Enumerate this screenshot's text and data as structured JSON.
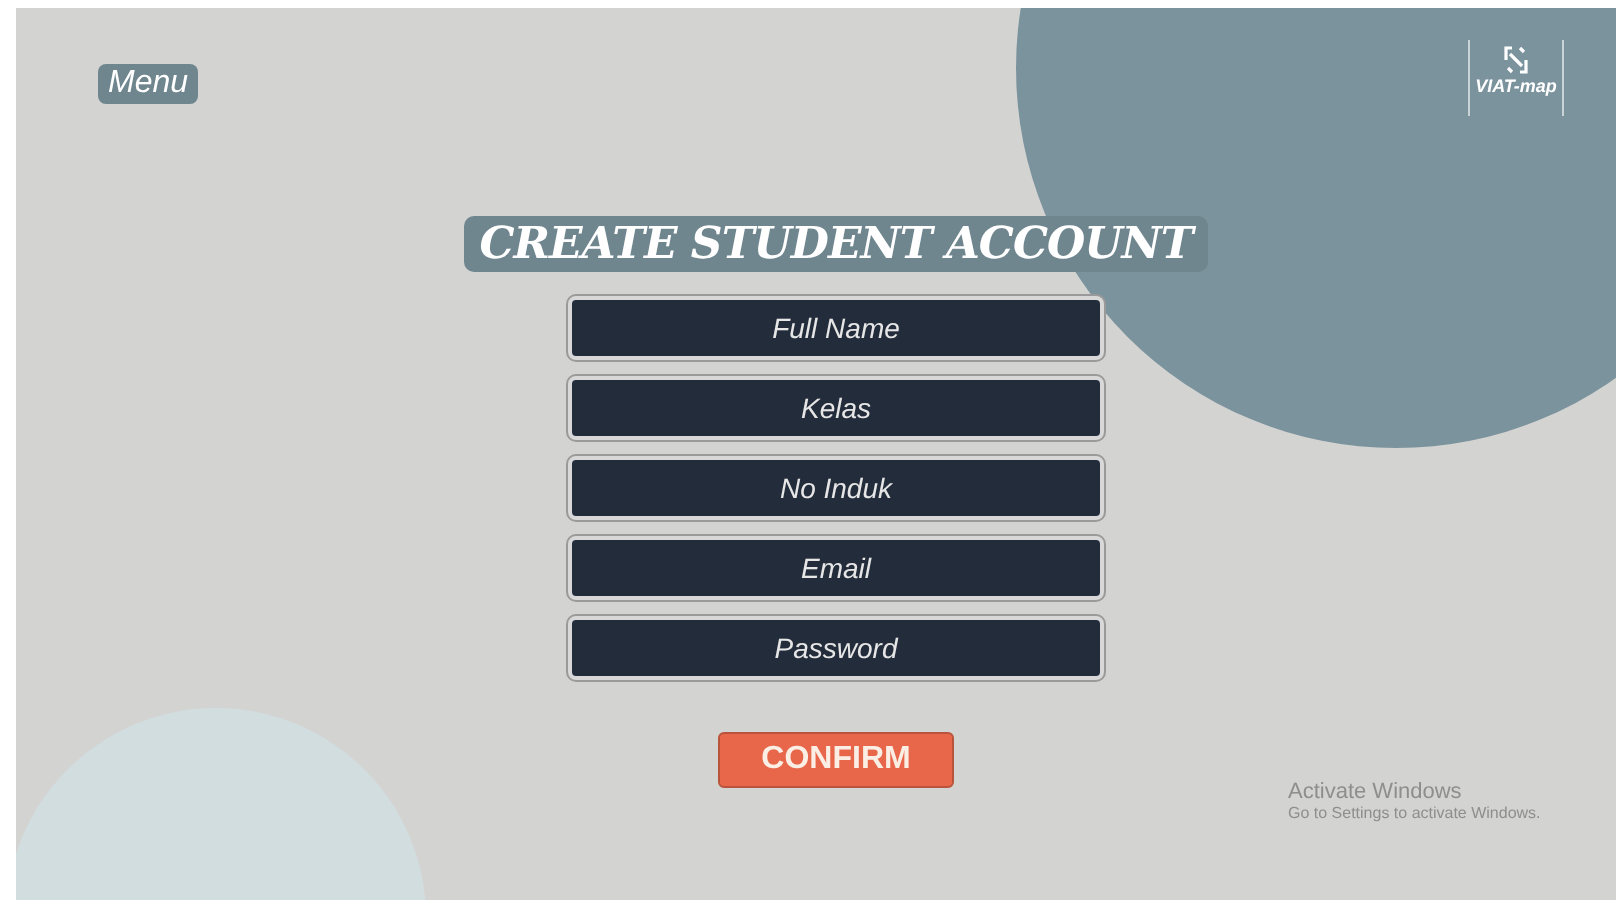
{
  "menu": {
    "label": "Menu"
  },
  "logo": {
    "label": "VIAT-map"
  },
  "title": "CREATE STUDENT ACCOUNT",
  "fields": [
    {
      "placeholder": "Full Name"
    },
    {
      "placeholder": "Kelas"
    },
    {
      "placeholder": "No Induk"
    },
    {
      "placeholder": "Email"
    },
    {
      "placeholder": "Password"
    }
  ],
  "confirm_button": "CONFIRM",
  "system_notice": {
    "title": "Activate Windows",
    "text": "Go to Settings to activate Windows."
  }
}
